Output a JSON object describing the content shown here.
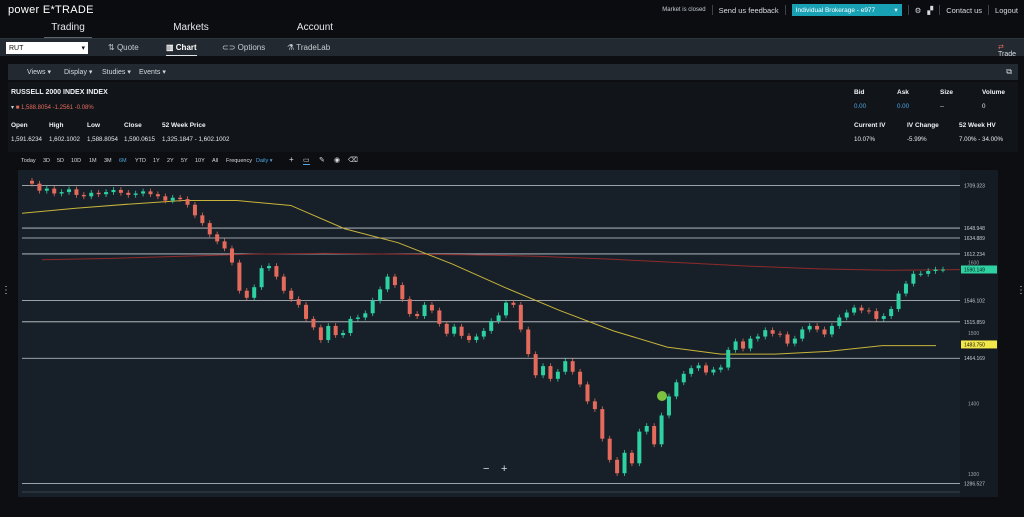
{
  "brand": {
    "logo": "power E*TRADE"
  },
  "topbar": {
    "market_status": "Market is closed",
    "feedback": "Send us feedback",
    "account": "Individual Brokerage - e977",
    "contact": "Contact us",
    "logout": "Logout"
  },
  "main_tabs": [
    {
      "label": "Trading"
    },
    {
      "label": "Markets"
    },
    {
      "label": "Account"
    }
  ],
  "sub_tabs": [
    {
      "label": "Quote"
    },
    {
      "label": "Chart"
    },
    {
      "label": "Options"
    },
    {
      "label": "TradeLab"
    }
  ],
  "symbol": {
    "value": "RUT"
  },
  "trade_button": "Trade",
  "menus": [
    {
      "label": "Views"
    },
    {
      "label": "Display"
    },
    {
      "label": "Studies"
    },
    {
      "label": "Events"
    }
  ],
  "quote": {
    "name": "RUSSELL 2000 INDEX INDEX",
    "change_line": "1,588.8054 -1.2561 -0.08%",
    "headers": {
      "open": "Open",
      "high": "High",
      "low": "Low",
      "close": "Close",
      "week52": "52 Week Price"
    },
    "values": {
      "open": "1,591.6234",
      "high": "1,602.1002",
      "low": "1,588.8054",
      "close": "1,590.0615",
      "week52": "1,325.1847 - 1,602.1002"
    },
    "bid": {
      "label": "Bid",
      "value": "0.00"
    },
    "ask": {
      "label": "Ask",
      "value": "0.00"
    },
    "size": {
      "label": "Size",
      "value": "--"
    },
    "volume": {
      "label": "Volume",
      "value": "0"
    },
    "current_iv": {
      "label": "Current IV",
      "value": "10.07%"
    },
    "iv_change": {
      "label": "IV Change",
      "value": "-5.99%"
    },
    "hv52": {
      "label": "52 Week HV",
      "value": "7.00% - 34.00%"
    }
  },
  "chart_toolbar": {
    "ranges": [
      "Today",
      "3D",
      "5D",
      "10D",
      "1M",
      "3M",
      "6M",
      "YTD",
      "1Y",
      "2Y",
      "5Y",
      "10Y",
      "All"
    ],
    "selected_range": "6M",
    "frequency_label": "Frequency",
    "frequency_value": "Daily"
  },
  "chart_data": {
    "type": "candlestick",
    "symbol": "RUT",
    "ylim": [
      1280,
      1720
    ],
    "y_ticks": [
      1300,
      1400,
      1500,
      1600
    ],
    "horizontal_levels": [
      1709.323,
      1648.948,
      1634.889,
      1612.234,
      1546.102,
      1515.859,
      1464.169,
      1286.527
    ],
    "price_tags": [
      {
        "value": "1590.149",
        "color": "#2ed1a2"
      },
      {
        "value": "1483.750",
        "color": "#f2e84a"
      }
    ],
    "closes": [
      1712,
      1702,
      1705,
      1698,
      1700,
      1704,
      1696,
      1694,
      1699,
      1697,
      1700,
      1703,
      1699,
      1696,
      1698,
      1701,
      1697,
      1694,
      1688,
      1692,
      1690,
      1682,
      1667,
      1656,
      1640,
      1630,
      1620,
      1600,
      1560,
      1550,
      1565,
      1592,
      1595,
      1580,
      1560,
      1548,
      1540,
      1520,
      1508,
      1490,
      1510,
      1497,
      1500,
      1520,
      1522,
      1528,
      1546,
      1562,
      1580,
      1568,
      1548,
      1527,
      1524,
      1540,
      1532,
      1513,
      1499,
      1509,
      1496,
      1490,
      1495,
      1503,
      1517,
      1525,
      1543,
      1540,
      1505,
      1470,
      1440,
      1453,
      1435,
      1445,
      1460,
      1445,
      1427,
      1403,
      1392,
      1350,
      1320,
      1301,
      1330,
      1315,
      1360,
      1368,
      1342,
      1383,
      1410,
      1430,
      1442,
      1450,
      1454,
      1444,
      1448,
      1451,
      1476,
      1488,
      1478,
      1492,
      1495,
      1504,
      1499,
      1498,
      1485,
      1492,
      1505,
      1510,
      1505,
      1498,
      1510,
      1522,
      1529,
      1536,
      1532,
      1531,
      1520,
      1524,
      1534,
      1556,
      1570,
      1584,
      1584,
      1588,
      1590,
      1590
    ],
    "ma_short": [
      1670,
      1677,
      1683,
      1688,
      1688,
      1681,
      1648,
      1628,
      1598,
      1564,
      1532,
      1503,
      1480,
      1470,
      1470,
      1474,
      1482,
      1482
    ],
    "ma_long": [
      1604,
      1606,
      1609,
      1612,
      1613,
      1612,
      1611,
      1609,
      1605,
      1600,
      1595,
      1591,
      1589,
      1590
    ]
  }
}
